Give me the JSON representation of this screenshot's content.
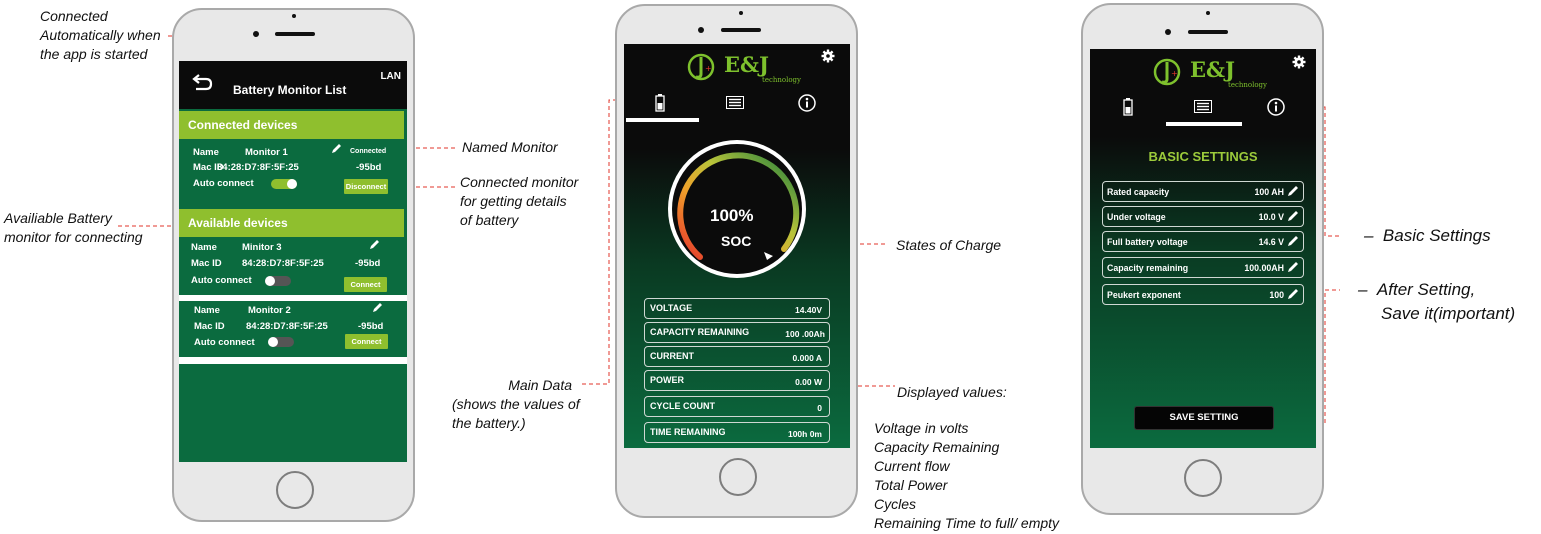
{
  "annotations": {
    "connected_auto": [
      "Connected",
      "Automatically when",
      "the app is started"
    ],
    "available_battery": [
      "Availiable Battery",
      "monitor for connecting"
    ],
    "named_monitor": "Named Monitor",
    "connected_monitor": [
      "Connected monitor",
      "for getting details",
      "of battery"
    ],
    "states_of_charge": "States of Charge",
    "main_data": [
      "Main Data",
      "(shows the values of",
      "the battery.)"
    ],
    "displayed_values_title": "Displayed values:",
    "displayed_values_list": [
      "Voltage in volts",
      "Capacity Remaining",
      "Current flow",
      "Total Power",
      "Cycles",
      "Remaining Time to full/ empty"
    ],
    "basic_settings": "Basic Settings",
    "after_setting": [
      "After Setting,",
      "Save it(important)"
    ],
    "dash": "–"
  },
  "phone1": {
    "lan": "LAN",
    "title": "Battery Monitor List",
    "connected_header": "Connected devices",
    "available_header": "Available devices",
    "devices": [
      {
        "name_label": "Name",
        "name": "Monitor 1",
        "mac_label": "Mac ID",
        "mac": "84:28:D7:8F:5F:25",
        "status": "Connected",
        "rssi": "-95bd",
        "auto_label": "Auto connect",
        "button": "Disconnect"
      },
      {
        "name_label": "Name",
        "name": "Minitor 3",
        "mac_label": "Mac ID",
        "mac": "84:28:D7:8F:5F:25",
        "rssi": "-95bd",
        "auto_label": "Auto connect",
        "button": "Connect"
      },
      {
        "name_label": "Name",
        "name": "Monitor 2",
        "mac_label": "Mac ID",
        "mac": "84:28:D7:8F:5F:25",
        "rssi": "-95bd",
        "auto_label": "Auto connect",
        "button": "Connect"
      }
    ]
  },
  "phone2": {
    "brand": "E&J",
    "brand_sub": "technology",
    "soc_value": "100%",
    "soc_label": "SOC",
    "rows": [
      {
        "label": "VOLTAGE",
        "value": "14.40V"
      },
      {
        "label": "CAPACITY REMAINING",
        "value": "100 .00Ah"
      },
      {
        "label": "CURRENT",
        "value": "0.000 A"
      },
      {
        "label": "POWER",
        "value": "0.00 W"
      },
      {
        "label": "CYCLE COUNT",
        "value": "0"
      },
      {
        "label": "TIME REMAINING",
        "value": "100h 0m"
      }
    ]
  },
  "phone3": {
    "brand": "E&J",
    "brand_sub": "technology",
    "heading": "BASIC SETTINGS",
    "rows": [
      {
        "label": "Rated capacity",
        "value": "100 AH"
      },
      {
        "label": "Under voltage",
        "value": "10.0 V"
      },
      {
        "label": "Full battery voltage",
        "value": "14.6 V"
      },
      {
        "label": "Capacity remaining",
        "value": "100.00AH"
      },
      {
        "label": "Peukert exponent",
        "value": "100"
      }
    ],
    "save_button": "SAVE SETTING"
  },
  "colors": {
    "accent_green": "#8fbf2e",
    "screen_green": "#0b6b3f",
    "annotation_line": "#e0352b"
  }
}
